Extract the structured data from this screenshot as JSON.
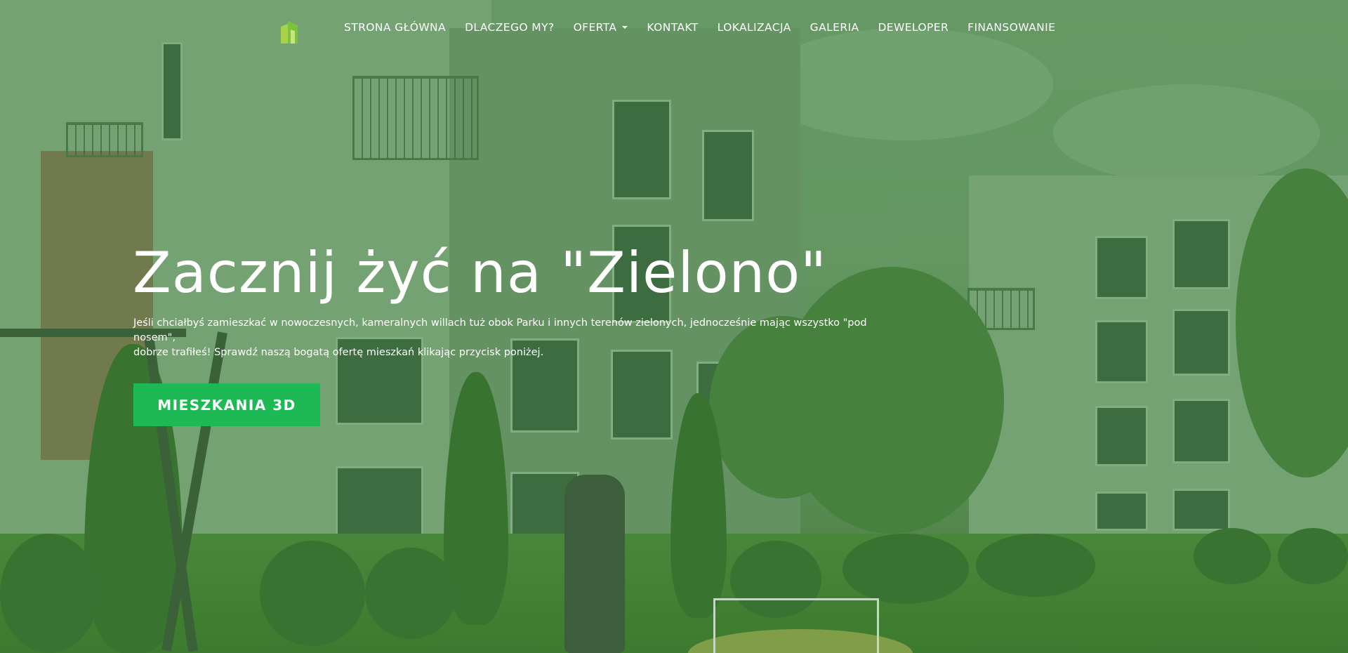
{
  "nav": {
    "logo_icon": "building-logo-icon",
    "items": [
      {
        "label": "STRONA GŁÓWNA"
      },
      {
        "label": "DLACZEGO MY?"
      },
      {
        "label": "OFERTA",
        "has_dropdown": true
      },
      {
        "label": "KONTAKT"
      },
      {
        "label": "LOKALIZACJA"
      },
      {
        "label": "GALERIA"
      },
      {
        "label": "DEWELOPER"
      },
      {
        "label": "FINANSOWANIE"
      }
    ]
  },
  "hero": {
    "headline": "Zacznij żyć na \"Zielono\"",
    "lead_line1": "Jeśli chciałbyś zamieszkać w nowoczesnych, kameralnych willach tuż obok Parku i innych terenów zielonych, jednocześnie mając wszystko \"pod nosem\",",
    "lead_line2": "dobrze trafiłeś! Sprawdź naszą bogatą ofertę mieszkań klikając przycisk poniżej.",
    "cta_label": "MIESZKANIA 3D",
    "background_image": "residential-buildings-park-photo"
  },
  "colors": {
    "overlay_green": "#2f8a2f",
    "cta_green": "#1db954",
    "text": "#ffffff"
  }
}
